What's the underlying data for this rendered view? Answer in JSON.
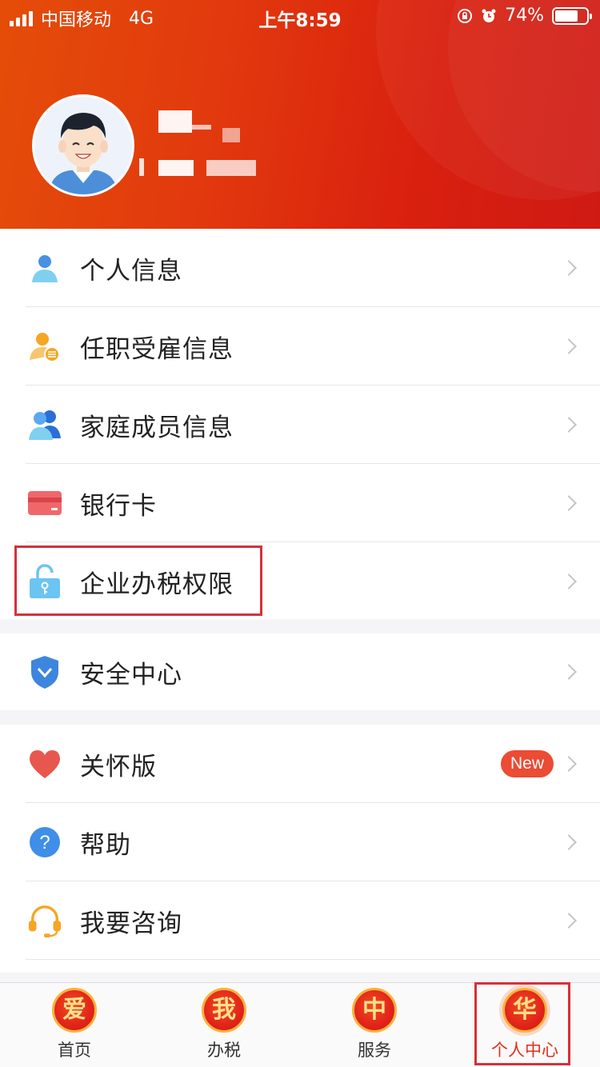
{
  "status_bar": {
    "carrier": "中国移动",
    "network": "4G",
    "time": "上午8:59",
    "battery": "74%",
    "battery_level": 0.74
  },
  "profile": {
    "avatar": "avatar-illustration"
  },
  "menu": {
    "group1": [
      {
        "label": "个人信息",
        "icon": "person-icon"
      },
      {
        "label": "任职受雇信息",
        "icon": "employment-icon"
      },
      {
        "label": "家庭成员信息",
        "icon": "family-icon"
      },
      {
        "label": "银行卡",
        "icon": "bank-card-icon"
      },
      {
        "label": "企业办税权限",
        "icon": "lock-icon"
      }
    ],
    "group2": [
      {
        "label": "安全中心",
        "icon": "shield-icon"
      }
    ],
    "group3": [
      {
        "label": "关怀版",
        "icon": "heart-icon",
        "badge": "New"
      },
      {
        "label": "帮助",
        "icon": "help-icon"
      },
      {
        "label": "我要咨询",
        "icon": "headset-icon"
      }
    ]
  },
  "tabbar": {
    "tabs": [
      {
        "glyph": "爱",
        "label": "首页"
      },
      {
        "glyph": "我",
        "label": "办税"
      },
      {
        "glyph": "中",
        "label": "服务"
      },
      {
        "glyph": "华",
        "label": "个人中心",
        "active": true
      }
    ]
  },
  "colors": {
    "accent": "#e22f1c",
    "highlight_box": "#d6303b",
    "badge": "#ec4b34"
  }
}
